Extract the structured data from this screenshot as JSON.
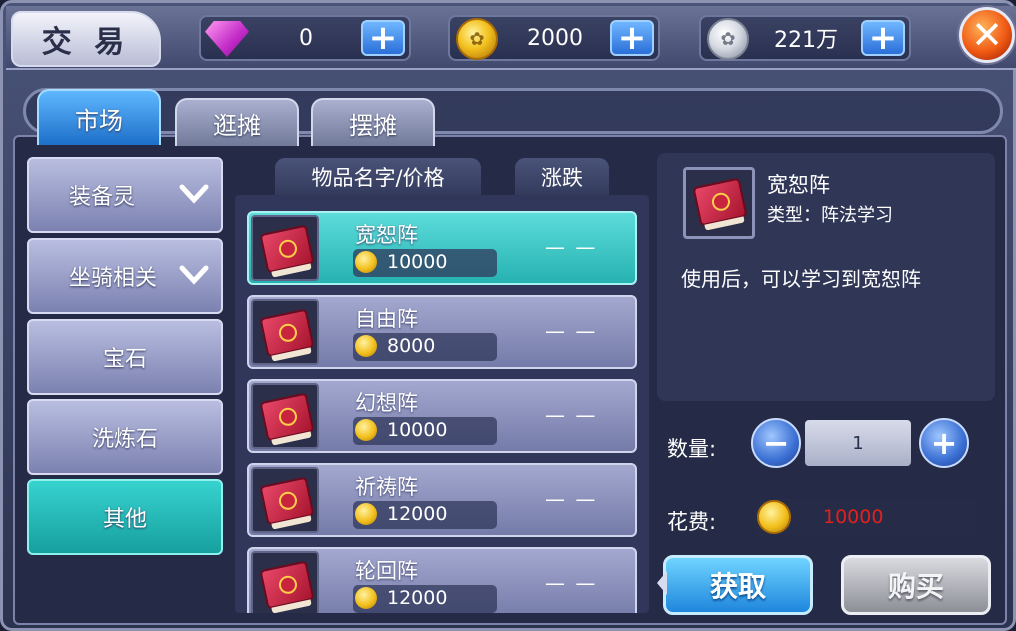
{
  "header": {
    "title": "交 易",
    "currencies": [
      {
        "icon": "gem-icon",
        "value": "0"
      },
      {
        "icon": "gold-coin-icon",
        "value": "2000"
      },
      {
        "icon": "silver-coin-icon",
        "value": "221万"
      }
    ]
  },
  "tabs": [
    {
      "label": "市场",
      "active": true
    },
    {
      "label": "逛摊",
      "active": false
    },
    {
      "label": "摆摊",
      "active": false
    }
  ],
  "categories": [
    {
      "label": "装备灵",
      "expandable": true,
      "active": false
    },
    {
      "label": "坐骑相关",
      "expandable": true,
      "active": false
    },
    {
      "label": "宝石",
      "expandable": false,
      "active": false
    },
    {
      "label": "洗炼石",
      "expandable": false,
      "active": false
    },
    {
      "label": "其他",
      "expandable": false,
      "active": true
    }
  ],
  "list": {
    "col_name": "物品名字/价格",
    "col_trend": "涨跌",
    "items": [
      {
        "name": "宽恕阵",
        "price": "10000",
        "trend": "— —",
        "selected": true
      },
      {
        "name": "自由阵",
        "price": "8000",
        "trend": "— —",
        "selected": false
      },
      {
        "name": "幻想阵",
        "price": "10000",
        "trend": "— —",
        "selected": false
      },
      {
        "name": "祈祷阵",
        "price": "12000",
        "trend": "— —",
        "selected": false
      },
      {
        "name": "轮回阵",
        "price": "12000",
        "trend": "— —",
        "selected": false
      }
    ]
  },
  "detail": {
    "name": "宽恕阵",
    "type": "类型：阵法学习",
    "description": "使用后，可以学习到宽恕阵"
  },
  "purchase": {
    "qty_label": "数量:",
    "qty_value": "1",
    "cost_label": "花费:",
    "cost_value": "10000",
    "get_label": "获取",
    "buy_label": "购买"
  },
  "colors": {
    "accent_teal": "#26b2b1",
    "cost_red": "#e3201c",
    "close_orange": "#f05a14"
  }
}
